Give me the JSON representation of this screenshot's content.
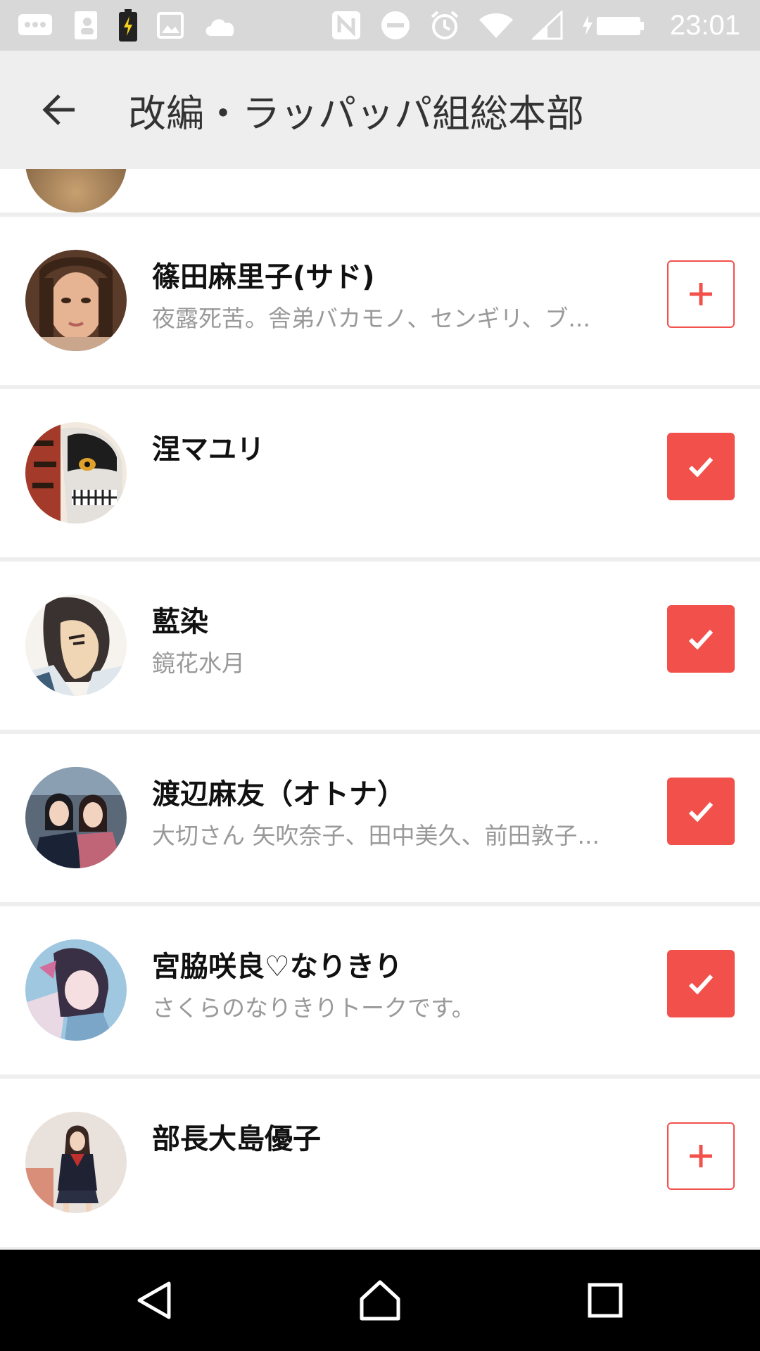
{
  "status_bar": {
    "time": "23:01",
    "icons_left": [
      "message-icon",
      "contacts-icon",
      "battery-charging-icon",
      "image-icon",
      "cloud-icon"
    ],
    "icons_right": [
      "nfc-icon",
      "do-not-disturb-icon",
      "alarm-icon",
      "wifi-icon",
      "signal-icon",
      "battery-icon"
    ]
  },
  "app_bar": {
    "back_icon": "arrow-left-icon",
    "title": "改編・ラッパッパ組総本部"
  },
  "colors": {
    "accent": "#f2504b",
    "title_text": "#333333",
    "secondary_text": "#999999",
    "background": "#eeeeee"
  },
  "members": [
    {
      "name": "篠田麻里子(サド)",
      "description": "夜露死苦。舎弟バカモノ、センギリ、ブ...",
      "state": "add",
      "icon": "plus-icon"
    },
    {
      "name": "涅マユリ",
      "description": "",
      "state": "added",
      "icon": "check-icon"
    },
    {
      "name": "藍染",
      "description": "鏡花水月",
      "state": "added",
      "icon": "check-icon"
    },
    {
      "name": "渡辺麻友（オトナ）",
      "description": "大切さん 矢吹奈子、田中美久、前田敦子...",
      "state": "added",
      "icon": "check-icon"
    },
    {
      "name": "宮脇咲良♡なりきり",
      "description": "さくらのなりきりトークです。",
      "state": "added",
      "icon": "check-icon"
    },
    {
      "name": "部長大島優子",
      "description": "",
      "state": "add",
      "icon": "plus-icon"
    }
  ],
  "nav_bar": {
    "buttons": [
      "back-triangle-icon",
      "home-icon",
      "recents-icon"
    ]
  }
}
